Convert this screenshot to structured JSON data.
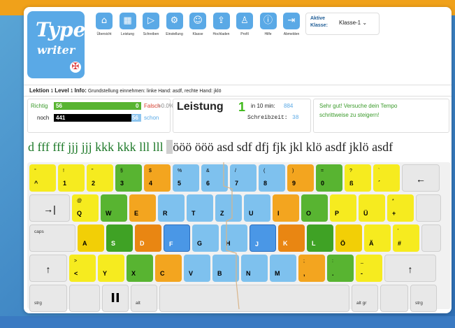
{
  "app": {
    "logo_line1": "Type",
    "logo_line2": "writer",
    "shield": "✠"
  },
  "nav": [
    {
      "label": "Übersicht",
      "icon": "⌂",
      "icon_name": "home-icon"
    },
    {
      "label": "Leistung",
      "icon": "▦",
      "icon_name": "chart-icon"
    },
    {
      "label": "Schreiben",
      "icon": "▷",
      "icon_name": "play-icon"
    },
    {
      "label": "Einstellung",
      "icon": "⚙",
      "icon_name": "gear-icon"
    },
    {
      "label": "Klasse",
      "icon": "☺",
      "icon_name": "group-icon"
    },
    {
      "label": "Hochladen",
      "icon": "⇪",
      "icon_name": "upload-icon"
    },
    {
      "label": "Profil",
      "icon": "♙",
      "icon_name": "user-icon"
    },
    {
      "label": "Hilfe",
      "icon": "ⓘ",
      "icon_name": "info-icon"
    },
    {
      "label": "Abmelden",
      "icon": "⇥",
      "icon_name": "logout-icon"
    }
  ],
  "klasse": {
    "label_line1": "Aktive",
    "label_line2": "Klasse:",
    "value": "Klasse-1 ⌄"
  },
  "lesson": {
    "lektion_label": "Lektion",
    "lektion_value": "1",
    "level_label": "Level",
    "level_value": "1",
    "info_label": "Info:",
    "info_text": "Grundstellung einnehmen: linke Hand: asdf, rechte Hand: jklö"
  },
  "stats": {
    "richtig_label": "Richtig",
    "richtig_value": "56",
    "falsch_value": "0",
    "falsch_label": "Falsch",
    "falsch_percent": "=0.0%",
    "noch_label": "noch",
    "noch_value": "441",
    "schon_value": "56",
    "schon_label": "schon",
    "progress_fraction": 0.113,
    "leistung_label": "Leistung",
    "leistung_value": "1",
    "time_label": "in 10 min:",
    "time_value": "884",
    "schreibzeit_label": "Schreibzeit:",
    "schreibzeit_value": "38",
    "message_line1": "Sehr gut! Versuche dein Tempo",
    "message_line2": "schrittweise zu steigern!"
  },
  "practice": {
    "done": "d fff fff jjj jjj kkk kkk lll lll ",
    "current": "ö",
    "rest": "ööö ööö asd sdf dfj fjk jkl klö asdf jklö asdf"
  },
  "keyboard": {
    "colors": {
      "yellow": "#f6eb1f",
      "orange": "#f3a51f",
      "green": "#58b431",
      "blue": "#7ec1ee",
      "blue_active": "#4a97e6",
      "dark_orange": "#e98612",
      "dark_green": "#3fa225",
      "dark_yellow": "#f2cf06",
      "gray": "#e8e8e8"
    },
    "rows": [
      [
        {
          "top": "°",
          "bottom": "^",
          "c": "yellow"
        },
        {
          "top": "!",
          "bottom": "1",
          "c": "yellow"
        },
        {
          "top": "\"",
          "bottom": "2",
          "c": "yellow"
        },
        {
          "top": "§",
          "bottom": "3",
          "c": "green"
        },
        {
          "top": "$",
          "bottom": "4",
          "c": "orange"
        },
        {
          "top": "%",
          "bottom": "5",
          "c": "blue"
        },
        {
          "top": "&",
          "bottom": "6",
          "c": "blue"
        },
        {
          "top": "/",
          "bottom": "7",
          "c": "blue"
        },
        {
          "top": "(",
          "bottom": "8",
          "c": "blue"
        },
        {
          "top": ")",
          "bottom": "9",
          "c": "orange"
        },
        {
          "top": "=",
          "bottom": "0",
          "c": "green"
        },
        {
          "top": "?",
          "bottom": "ß",
          "c": "yellow"
        },
        {
          "top": "`",
          "bottom": "´",
          "c": "yellow"
        },
        {
          "mid": "←",
          "c": "gray"
        }
      ],
      [
        {
          "mid": "→|",
          "c": "gray"
        },
        {
          "top": "@",
          "bottom": "Q",
          "c": "yellow"
        },
        {
          "bottom": "W",
          "c": "green"
        },
        {
          "bottom": "E",
          "c": "orange"
        },
        {
          "bottom": "R",
          "c": "blue"
        },
        {
          "bottom": "T",
          "c": "blue"
        },
        {
          "bottom": "Z",
          "c": "blue"
        },
        {
          "bottom": "U",
          "c": "blue"
        },
        {
          "bottom": "I",
          "c": "orange"
        },
        {
          "bottom": "O",
          "c": "green"
        },
        {
          "bottom": "P",
          "c": "yellow"
        },
        {
          "bottom": "Ü",
          "c": "yellow"
        },
        {
          "top": "*",
          "bottom": "+",
          "c": "yellow"
        },
        {
          "c": "gray"
        }
      ],
      [
        {
          "small": "caps",
          "c": "gray"
        },
        {
          "bottom": "A",
          "c": "dark_yellow"
        },
        {
          "bottom": "S",
          "c": "dark_green"
        },
        {
          "bottom": "D",
          "c": "dark_orange"
        },
        {
          "bottom": "F",
          "c": "blue_active"
        },
        {
          "bottom": "G",
          "c": "blue"
        },
        {
          "bottom": "H",
          "c": "blue"
        },
        {
          "bottom": "J",
          "c": "blue_active"
        },
        {
          "bottom": "K",
          "c": "dark_orange"
        },
        {
          "bottom": "L",
          "c": "dark_green"
        },
        {
          "bottom": "Ö",
          "c": "dark_yellow"
        },
        {
          "bottom": "Ä",
          "c": "yellow"
        },
        {
          "top": "'",
          "bottom": "#",
          "c": "yellow"
        },
        {
          "c": "gray"
        }
      ],
      [
        {
          "mid": "↑",
          "c": "gray"
        },
        {
          "top": ">",
          "bottom": "<",
          "c": "yellow"
        },
        {
          "bottom": "Y",
          "c": "yellow"
        },
        {
          "bottom": "X",
          "c": "green"
        },
        {
          "bottom": "C",
          "c": "orange"
        },
        {
          "bottom": "V",
          "c": "blue"
        },
        {
          "bottom": "B",
          "c": "blue"
        },
        {
          "bottom": "N",
          "c": "blue"
        },
        {
          "bottom": "M",
          "c": "blue"
        },
        {
          "top": ";",
          "bottom": ",",
          "c": "orange"
        },
        {
          "top": ":",
          "bottom": ".",
          "c": "green"
        },
        {
          "top": "_",
          "bottom": "-",
          "c": "yellow"
        },
        {
          "mid": "↑",
          "c": "gray"
        }
      ],
      [
        {
          "small": "strg",
          "c": "gray"
        },
        {
          "c": "gray"
        },
        {
          "big": "II",
          "c": "gray"
        },
        {
          "small": "alt",
          "c": "gray"
        },
        {
          "c": "gray"
        },
        {
          "small": "alt gr",
          "c": "gray"
        },
        {
          "c": "gray"
        },
        {
          "small": "strg",
          "c": "gray"
        }
      ]
    ]
  }
}
